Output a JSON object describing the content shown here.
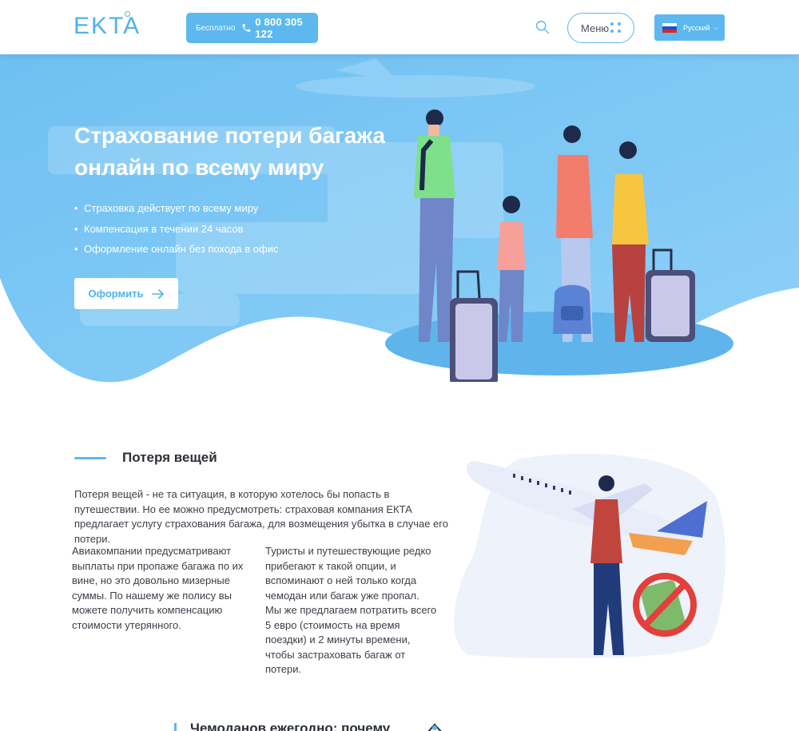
{
  "header": {
    "logo": "EKTA",
    "phone_free": "Бесплатно",
    "phone_number": "0 800 305 122",
    "menu_label": "Меню",
    "language": "Русский"
  },
  "hero": {
    "title": "Страхование потери багажа онлайн по всему миру",
    "bullets": [
      "Страховка действует по всему миру",
      "Компенсация в течении 24 часов",
      "Оформление онлайн без похода в офис"
    ],
    "order_label": "Оформить"
  },
  "section": {
    "title": "Потеря вещей",
    "intro": "Потеря вещей - не та ситуация, в которую хотелось бы попасть в путешествии. Но ее можно предусмотреть: страховая компания ЕКТА предлагает услугу страхования багажа, для возмещения убытка в случае его потери.",
    "col_left": "Авиакомпании предусматривают выплаты при пропаже багажа по их вине, но это довольно мизерные суммы. По нашему же полису вы можете получить компенсацию стоимости утерянного.",
    "col_right": "Туристы и путешествующие редко прибегают к такой опции, и вспоминают о ней только когда чемодан или багаж уже пропал. Мы же предлагаем потратить всего 5 евро (стоимость на время поездки) и 2 минуты времени, чтобы застраховать багаж от потери."
  },
  "section3": {
    "title": "Чемоданов ежегодно: почему"
  },
  "colors": {
    "accent": "#5cb8ef",
    "hero_bg": "#7ec8f4"
  }
}
